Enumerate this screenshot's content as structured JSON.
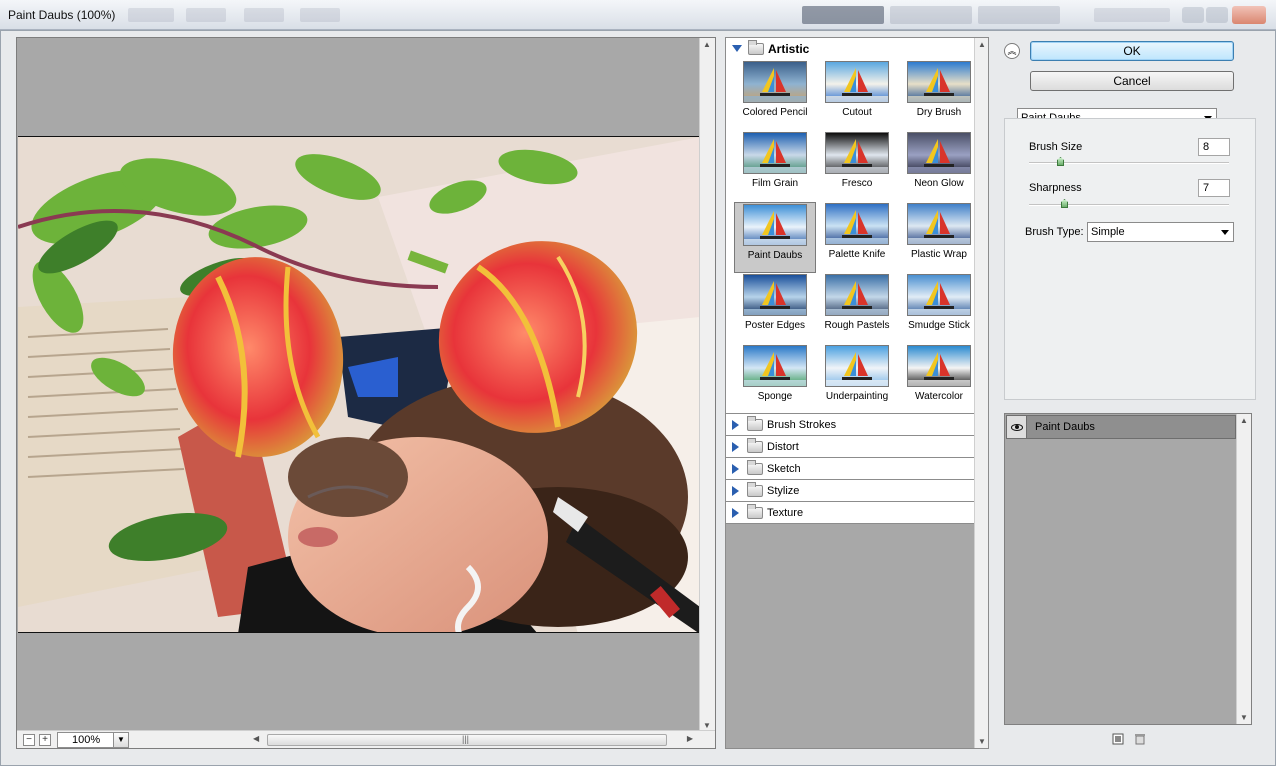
{
  "window": {
    "title": "Paint Daubs (100%)"
  },
  "preview": {
    "zoom_value": "100%",
    "zoom_out_glyph": "−",
    "zoom_in_glyph": "+",
    "hscroll_grip": "|||"
  },
  "gallery": {
    "open_category": "Artistic",
    "filters": [
      {
        "label": "Colored Pencil",
        "selected": false
      },
      {
        "label": "Cutout",
        "selected": false
      },
      {
        "label": "Dry Brush",
        "selected": false
      },
      {
        "label": "Film Grain",
        "selected": false
      },
      {
        "label": "Fresco",
        "selected": false
      },
      {
        "label": "Neon Glow",
        "selected": false
      },
      {
        "label": "Paint Daubs",
        "selected": true
      },
      {
        "label": "Palette Knife",
        "selected": false
      },
      {
        "label": "Plastic Wrap",
        "selected": false
      },
      {
        "label": "Poster Edges",
        "selected": false
      },
      {
        "label": "Rough Pastels",
        "selected": false
      },
      {
        "label": "Smudge Stick",
        "selected": false
      },
      {
        "label": "Sponge",
        "selected": false
      },
      {
        "label": "Underpainting",
        "selected": false
      },
      {
        "label": "Watercolor",
        "selected": false
      }
    ],
    "closed_categories": [
      "Brush Strokes",
      "Distort",
      "Sketch",
      "Stylize",
      "Texture"
    ]
  },
  "controls": {
    "ok_label": "OK",
    "cancel_label": "Cancel",
    "filter_select": "Paint Daubs",
    "brush_size_label": "Brush Size",
    "brush_size_value": "8",
    "brush_size_fraction": 0.16,
    "sharpness_label": "Sharpness",
    "sharpness_value": "7",
    "sharpness_fraction": 0.18,
    "brush_type_label": "Brush Type:",
    "brush_type_value": "Simple"
  },
  "layers": {
    "items": [
      {
        "name": "Paint Daubs"
      }
    ]
  },
  "colors": {
    "ok_border": "#3c7fb1",
    "selection_blue": "#2a5fb0"
  }
}
